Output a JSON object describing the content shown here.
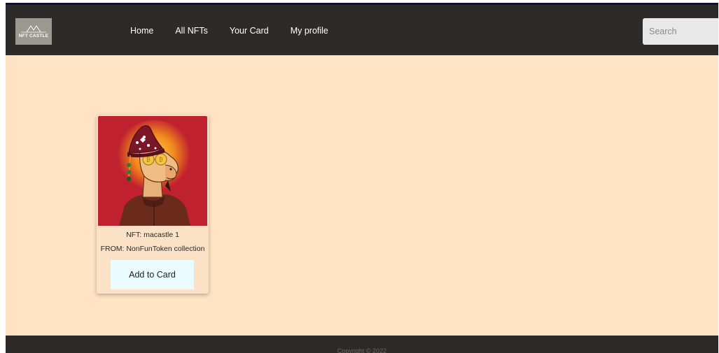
{
  "nav": {
    "logo_text": "NFT CASTLE",
    "links": [
      {
        "label": "Home"
      },
      {
        "label": "All NFTs"
      },
      {
        "label": "Your Card"
      },
      {
        "label": "My profile"
      }
    ],
    "search_placeholder": "Search"
  },
  "colors": {
    "navbar_bg": "#2d2a29",
    "page_bg": "#ffe3c4",
    "card_bg": "#fbe1c6",
    "button_bg": "#eafcff",
    "nft_background": "#c0212e"
  },
  "nft_card": {
    "image_icon": "camel-nft-art",
    "title": "NFT: macastle 1",
    "from": "FROM: NonFunToken collection",
    "button_label": "Add to Card"
  },
  "footer": {
    "text": "Copyright © 2022"
  }
}
